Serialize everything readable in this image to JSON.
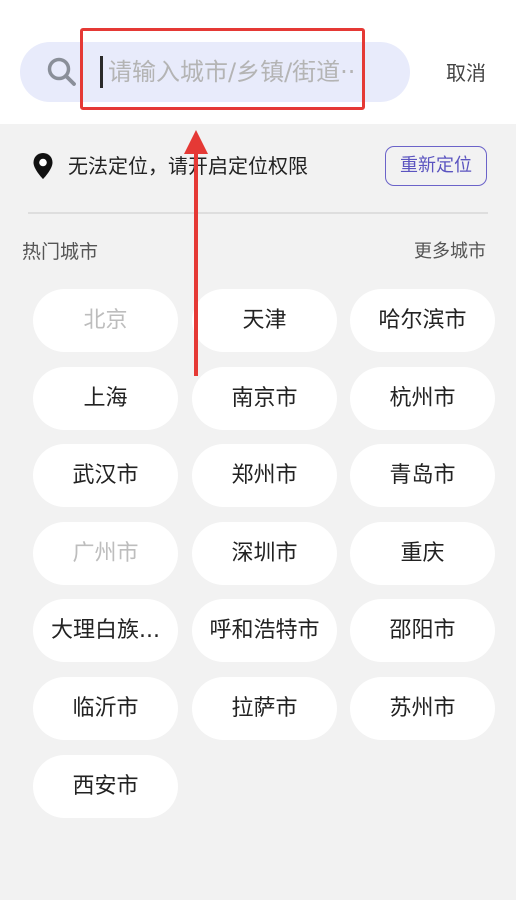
{
  "search": {
    "placeholder": "请输入城市/乡镇/街道··",
    "cancel_label": "取消"
  },
  "location": {
    "message": "无法定位，请开启定位权限",
    "relocate_label": "重新定位"
  },
  "hot_cities": {
    "title": "热门城市",
    "more_label": "更多城市",
    "items": [
      {
        "label": "北京",
        "disabled": true
      },
      {
        "label": "天津",
        "disabled": false
      },
      {
        "label": "哈尔滨市",
        "disabled": false
      },
      {
        "label": "上海",
        "disabled": false
      },
      {
        "label": "南京市",
        "disabled": false
      },
      {
        "label": "杭州市",
        "disabled": false
      },
      {
        "label": "武汉市",
        "disabled": false
      },
      {
        "label": "郑州市",
        "disabled": false
      },
      {
        "label": "青岛市",
        "disabled": false
      },
      {
        "label": "广州市",
        "disabled": true
      },
      {
        "label": "深圳市",
        "disabled": false
      },
      {
        "label": "重庆",
        "disabled": false
      },
      {
        "label": "大理白族...",
        "disabled": false
      },
      {
        "label": "呼和浩特市",
        "disabled": false
      },
      {
        "label": "邵阳市",
        "disabled": false
      },
      {
        "label": "临沂市",
        "disabled": false
      },
      {
        "label": "拉萨市",
        "disabled": false
      },
      {
        "label": "苏州市",
        "disabled": false
      },
      {
        "label": "西安市",
        "disabled": false
      }
    ]
  },
  "colors": {
    "accent": "#5b54c0",
    "search_bg": "#e8ebfb",
    "highlight": "#e53935",
    "disabled_text": "#bdbdbd"
  },
  "icons": [
    "search-icon",
    "location-pin-icon",
    "arrow-up-icon"
  ]
}
